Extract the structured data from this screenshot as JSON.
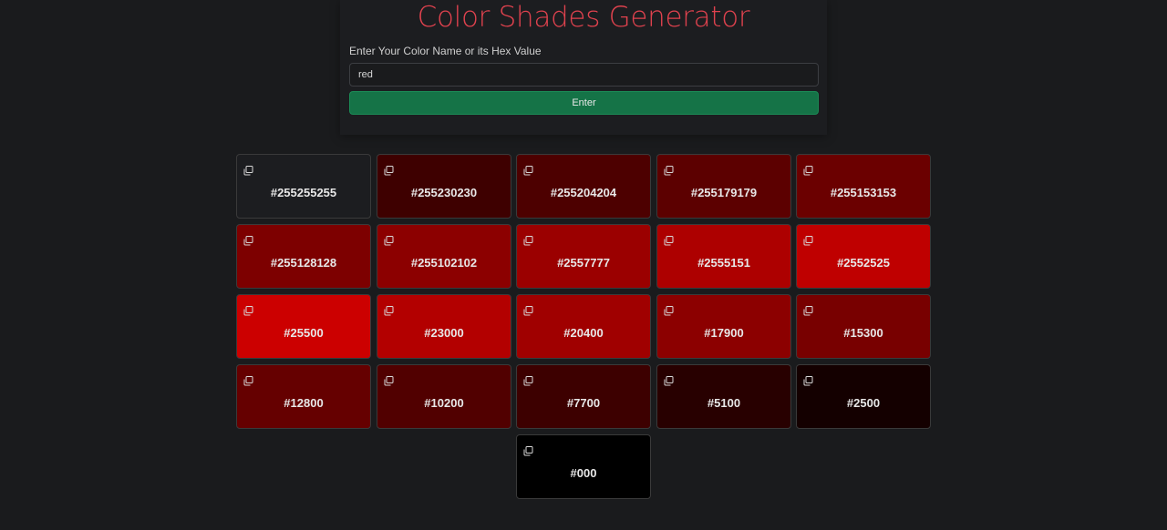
{
  "header": {
    "title": "Color Shades Generator"
  },
  "form": {
    "label": "Enter Your Color Name or its Hex Value",
    "input_value": "red",
    "button_label": "Enter"
  },
  "swatches": [
    {
      "hex": "#255255255",
      "bg": "#1c1d20"
    },
    {
      "hex": "#255230230",
      "bg": "#3e0000"
    },
    {
      "hex": "#255204204",
      "bg": "#4d0000"
    },
    {
      "hex": "#255179179",
      "bg": "#5c0000"
    },
    {
      "hex": "#255153153",
      "bg": "#6b0000"
    },
    {
      "hex": "#255128128",
      "bg": "#7d0000"
    },
    {
      "hex": "#255102102",
      "bg": "#8c0000"
    },
    {
      "hex": "#2557777",
      "bg": "#9b0000"
    },
    {
      "hex": "#2555151",
      "bg": "#ad0000"
    },
    {
      "hex": "#2552525",
      "bg": "#bf0000"
    },
    {
      "hex": "#25500",
      "bg": "#cc0000"
    },
    {
      "hex": "#23000",
      "bg": "#b30000"
    },
    {
      "hex": "#20400",
      "bg": "#a00000"
    },
    {
      "hex": "#17900",
      "bg": "#8c0000"
    },
    {
      "hex": "#15300",
      "bg": "#780000"
    },
    {
      "hex": "#12800",
      "bg": "#650000"
    },
    {
      "hex": "#10200",
      "bg": "#510000"
    },
    {
      "hex": "#7700",
      "bg": "#3d0000"
    },
    {
      "hex": "#5100",
      "bg": "#280000"
    },
    {
      "hex": "#2500",
      "bg": "#140000"
    },
    {
      "hex": "#000",
      "bg": "#000000"
    }
  ],
  "icons": {
    "copy": "copy-icon"
  }
}
